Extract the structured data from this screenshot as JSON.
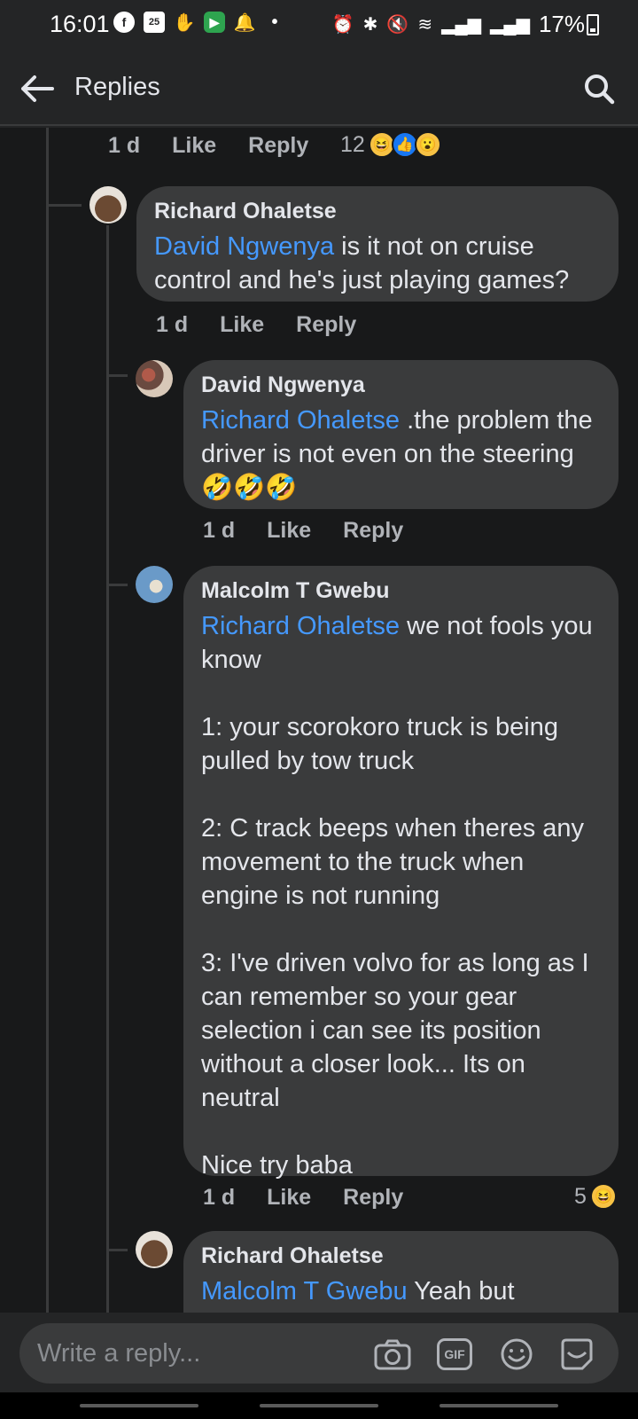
{
  "status_bar": {
    "time": "16:01",
    "calendar_day": "25",
    "battery": "17%"
  },
  "header": {
    "title": "Replies"
  },
  "top_meta": {
    "time": "1 d",
    "like": "Like",
    "reply": "Reply",
    "reaction_count": "12"
  },
  "comments": [
    {
      "author": "Richard Ohaletse",
      "mention": "David Ngwenya",
      "text": " is it not on cruise control and he's just playing games?",
      "time": "1 d",
      "like": "Like",
      "reply": "Reply"
    },
    {
      "author": "David Ngwenya",
      "mention": "Richard Ohaletse",
      "text": " .the problem the driver is not even on the steering🤣🤣🤣",
      "time": "1 d",
      "like": "Like",
      "reply": "Reply"
    },
    {
      "author": "Malcolm T Gwebu",
      "mention": "Richard Ohaletse",
      "text": " we not fools you know\n\n1: your scorokoro truck is being pulled by tow truck\n\n2: C track beeps when theres any movement to the truck when engine is not running\n\n3: I've driven volvo for as long as I can remember so your gear selection i can see its position without a closer look... Its on neutral\n\nNice try baba",
      "time": "1 d",
      "like": "Like",
      "reply": "Reply",
      "reaction_count": "5"
    },
    {
      "author": "Richard Ohaletse",
      "mention": "Malcolm T Gwebu",
      "text": " Yeah but"
    }
  ],
  "composer": {
    "placeholder": "Write a reply...",
    "gif_label": "GIF"
  }
}
